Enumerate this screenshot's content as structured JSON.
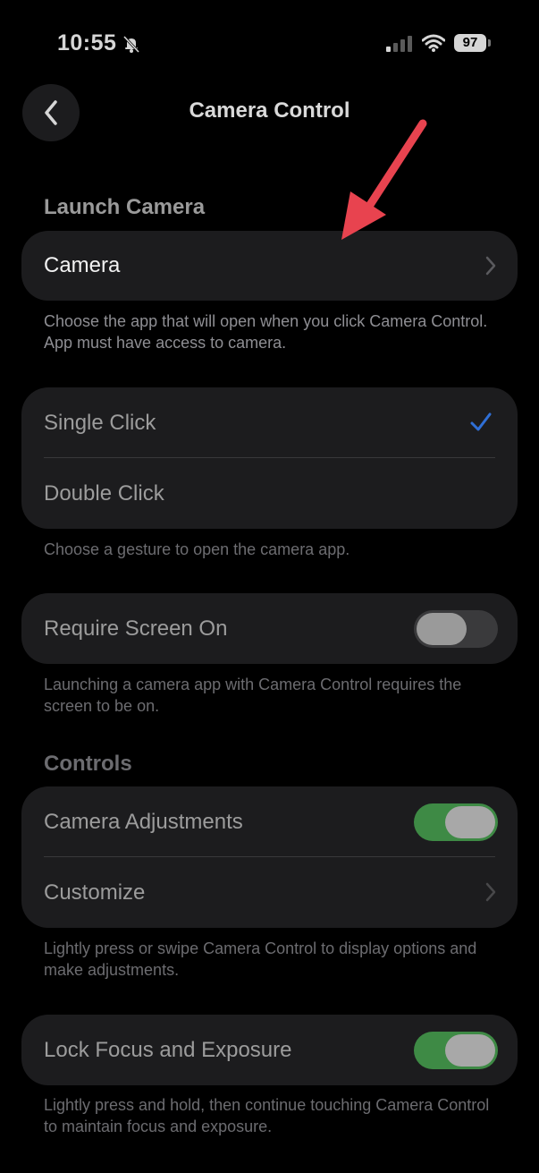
{
  "status_bar": {
    "time": "10:55",
    "battery": "97",
    "icons": [
      "bell-slash-icon",
      "cellular-signal-icon",
      "wifi-icon",
      "battery-icon"
    ]
  },
  "nav": {
    "title": "Camera Control",
    "back_icon": "chevron-left-icon"
  },
  "launch_camera": {
    "header": "Launch Camera",
    "app_label": "Camera",
    "footnote": "Choose the app that will open when you click Camera Control. App must have access to camera."
  },
  "gesture": {
    "options": [
      {
        "label": "Single Click",
        "selected": true
      },
      {
        "label": "Double Click",
        "selected": false
      }
    ],
    "footnote": "Choose a gesture to open the camera app."
  },
  "require_screen": {
    "label": "Require Screen On",
    "enabled": false,
    "footnote": "Launching a camera app with Camera Control requires the screen to be on."
  },
  "controls": {
    "header": "Controls",
    "adjustments_label": "Camera Adjustments",
    "adjustments_enabled": true,
    "customize_label": "Customize",
    "footnote": "Lightly press or swipe Camera Control to display options and make adjustments."
  },
  "lock_focus": {
    "label": "Lock Focus and Exposure",
    "enabled": true,
    "footnote": "Lightly press and hold, then continue touching Camera Control to maintain focus and exposure."
  },
  "colors": {
    "background": "#000000",
    "card": "#1c1c1e",
    "toggle_on": "#3e8a45",
    "checkmark": "#2f6fd6",
    "annotation_arrow": "#e8434f"
  }
}
